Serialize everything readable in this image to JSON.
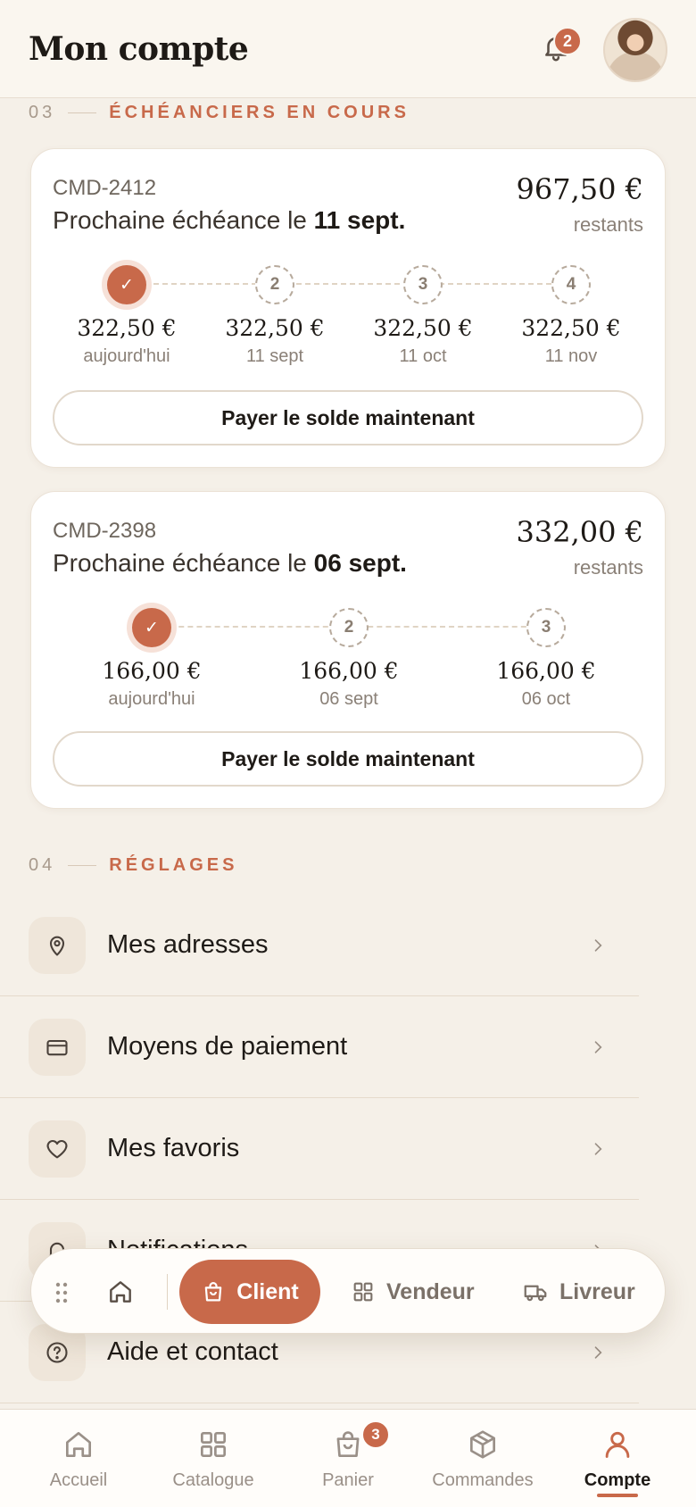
{
  "header": {
    "title": "Mon compte",
    "notification_count": "2"
  },
  "schedules_section": {
    "number": "03",
    "title": "ÉCHÉANCIERS EN COURS"
  },
  "schedules": [
    {
      "ref": "CMD-2412",
      "next_prefix": "Prochaine échéance le ",
      "next_date": "11 sept.",
      "amount": "967,50 €",
      "remaining": "restants",
      "steps": [
        {
          "mark": "✓",
          "done": true,
          "value": "322,50 €",
          "date": "aujourd'hui"
        },
        {
          "mark": "2",
          "done": false,
          "value": "322,50 €",
          "date": "11 sept"
        },
        {
          "mark": "3",
          "done": false,
          "value": "322,50 €",
          "date": "11 oct"
        },
        {
          "mark": "4",
          "done": false,
          "value": "322,50 €",
          "date": "11 nov"
        }
      ],
      "button": "Payer le solde maintenant"
    },
    {
      "ref": "CMD-2398",
      "next_prefix": "Prochaine échéance le ",
      "next_date": "06 sept.",
      "amount": "332,00 €",
      "remaining": "restants",
      "steps": [
        {
          "mark": "✓",
          "done": true,
          "value": "166,00 €",
          "date": "aujourd'hui"
        },
        {
          "mark": "2",
          "done": false,
          "value": "166,00 €",
          "date": "06 sept"
        },
        {
          "mark": "3",
          "done": false,
          "value": "166,00 €",
          "date": "06 oct"
        }
      ],
      "button": "Payer le solde maintenant"
    }
  ],
  "settings_section": {
    "number": "04",
    "title": "RÉGLAGES"
  },
  "settings": [
    {
      "label": "Mes adresses",
      "icon": "map-pin-icon"
    },
    {
      "label": "Moyens de paiement",
      "icon": "credit-card-icon"
    },
    {
      "label": "Mes favoris",
      "icon": "heart-icon"
    },
    {
      "label": "Notifications",
      "icon": "bell-icon"
    },
    {
      "label": "Aide et contact",
      "icon": "help-circle-icon"
    }
  ],
  "role_switcher": {
    "active": "Client",
    "vendor": "Vendeur",
    "courier": "Livreur"
  },
  "bottom_nav": {
    "items": [
      {
        "label": "Accueil",
        "icon": "home-icon"
      },
      {
        "label": "Catalogue",
        "icon": "grid-icon"
      },
      {
        "label": "Panier",
        "icon": "bag-icon",
        "badge": "3"
      },
      {
        "label": "Commandes",
        "icon": "box-icon"
      },
      {
        "label": "Compte",
        "icon": "user-icon",
        "active": true
      }
    ]
  },
  "colors": {
    "accent": "#c8694a",
    "background": "#f5f0e8",
    "card": "#ffffff"
  }
}
